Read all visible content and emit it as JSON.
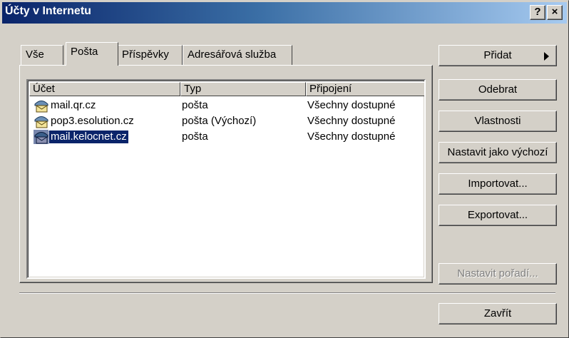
{
  "window": {
    "title": "Účty v Internetu"
  },
  "titlebar": {
    "help_label": "?",
    "close_label": "×"
  },
  "tabs": [
    {
      "label": "Vše"
    },
    {
      "label": "Pošta"
    },
    {
      "label": "Příspěvky"
    },
    {
      "label": "Adresářová služba"
    }
  ],
  "active_tab": "Pošta",
  "table": {
    "columns": [
      "Účet",
      "Typ",
      "Připojení"
    ],
    "rows": [
      {
        "account": "mail.qr.cz",
        "type": "pošta",
        "connection": "Všechny dostupné",
        "selected": false
      },
      {
        "account": "pop3.esolution.cz",
        "type": "pošta (Výchozí)",
        "connection": "Všechny dostupné",
        "selected": false
      },
      {
        "account": "mail.kelocnet.cz",
        "type": "pošta",
        "connection": "Všechny dostupné",
        "selected": true
      }
    ]
  },
  "buttons": {
    "add": "Přidat",
    "remove": "Odebrat",
    "properties": "Vlastnosti",
    "set_default": "Nastavit jako výchozí",
    "import": "Importovat...",
    "export": "Exportovat...",
    "set_order": "Nastavit pořadí...",
    "close": "Zavřít"
  },
  "icons": {
    "account": "mail-account-icon",
    "add_arrow": "triangle-right-icon"
  },
  "colors": {
    "selection": "#0a246a",
    "titlebar_start": "#0a246a",
    "titlebar_end": "#a6caf0"
  }
}
